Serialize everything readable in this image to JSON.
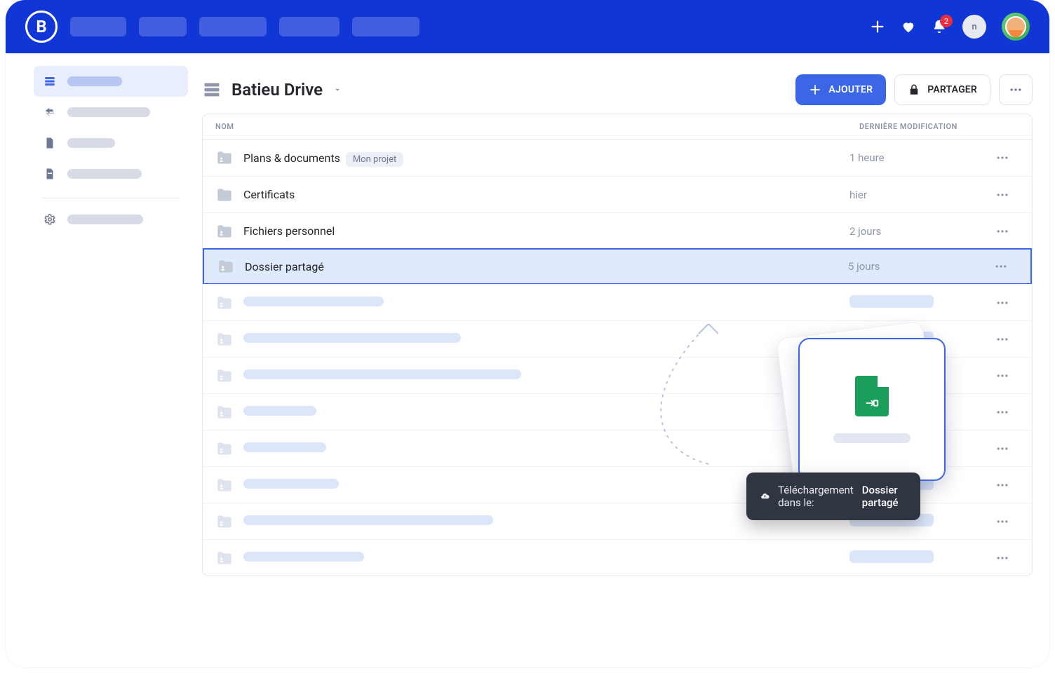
{
  "header": {
    "logo_letter": "B",
    "notification_count": "2",
    "small_avatar_initials": "n"
  },
  "page": {
    "title": "Batieu Drive",
    "add_label": "AJOUTER",
    "share_label": "PARTAGER"
  },
  "columns": {
    "name": "NOM",
    "modified": "DERNIÈRE MODIFICATION"
  },
  "rows": [
    {
      "name": "Plans & documents",
      "tag": "Mon projet",
      "date": "1 heure"
    },
    {
      "name": "Certificats",
      "tag": "",
      "date": "hier"
    },
    {
      "name": "Fichiers personnel",
      "tag": "",
      "date": "2 jours"
    },
    {
      "name": "Dossier partagé",
      "tag": "",
      "date": "5 jours"
    }
  ],
  "placeholder_row_widths": [
    200,
    310,
    396,
    104,
    118,
    136,
    356,
    172
  ],
  "upload": {
    "prefix": "Téléchargement dans le:",
    "target": "Dossier partagé"
  }
}
